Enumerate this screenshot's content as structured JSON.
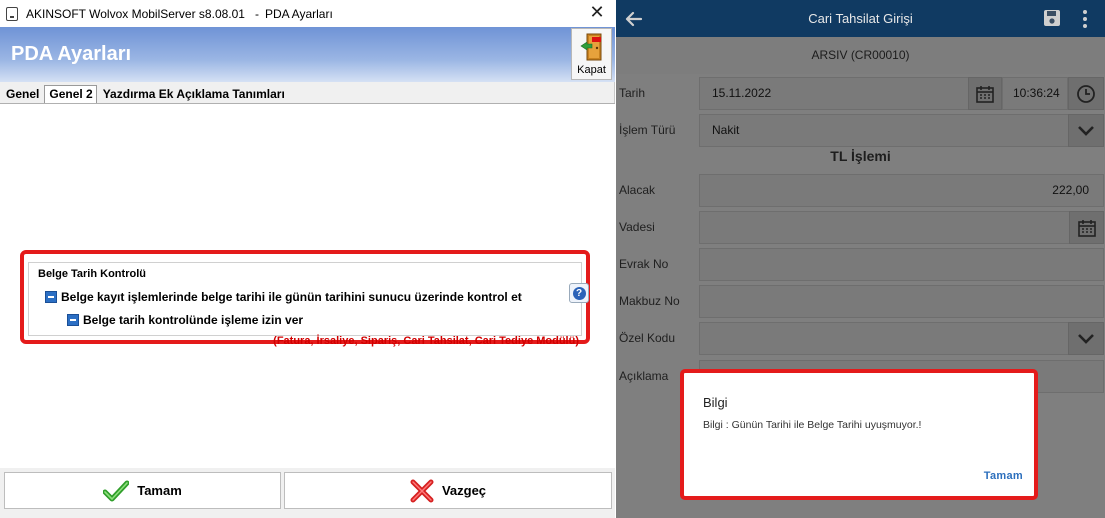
{
  "left_window": {
    "title_app": "AKINSOFT Wolvox MobilServer s8.08.01",
    "title_sep": "-",
    "title_dialog": "PDA Ayarları",
    "close_glyph": "✕",
    "banner_title": "PDA Ayarları",
    "close_button_label": "Kapat",
    "tabs": [
      {
        "label": "Genel",
        "active": false
      },
      {
        "label": "Genel 2",
        "active": true
      },
      {
        "label": "Yazdırma Ek Açıklama Tanımları",
        "active": false
      }
    ],
    "group": {
      "title": "Belge Tarih Kontrolü",
      "option1": "Belge kayıt işlemlerinde belge tarihi ile günün tarihini sunucu üzerinde kontrol et",
      "option2": "Belge tarih kontrolünde işleme izin ver",
      "modules_note": "(Fatura, İrsaliye, Sipariş, Cari Tahsilat, Cari Tediye Modülü)",
      "help_glyph": "?"
    },
    "footer": {
      "ok_label": "Tamam",
      "cancel_label": "Vazgeç"
    },
    "accent_color": "#e41b1b"
  },
  "phone": {
    "appbar_title": "Cari Tahsilat Girişi",
    "subheader": "ARSIV (CR00010)",
    "fields": {
      "tarih_label": "Tarih",
      "tarih_value": "15.11.2022",
      "saat_value": "10:36:24",
      "islem_turu_label": "İşlem Türü",
      "islem_turu_value": "Nakit",
      "section_title": "TL İşlemi",
      "alacak_label": "Alacak",
      "alacak_value": "222,00",
      "vadesi_label": "Vadesi",
      "evrak_no_label": "Evrak No",
      "makbuz_no_label": "Makbuz No",
      "ozel_kodu_label": "Özel Kodu",
      "aciklama_label": "Açıklama"
    },
    "dialog": {
      "title": "Bilgi",
      "message": "Bilgi : Günün Tarihi ile Belge Tarihi uyuşmuyor.!",
      "ok_label": "Tamam"
    },
    "primary_color": "#1e6ab3",
    "link_color": "#2c6fbd"
  }
}
